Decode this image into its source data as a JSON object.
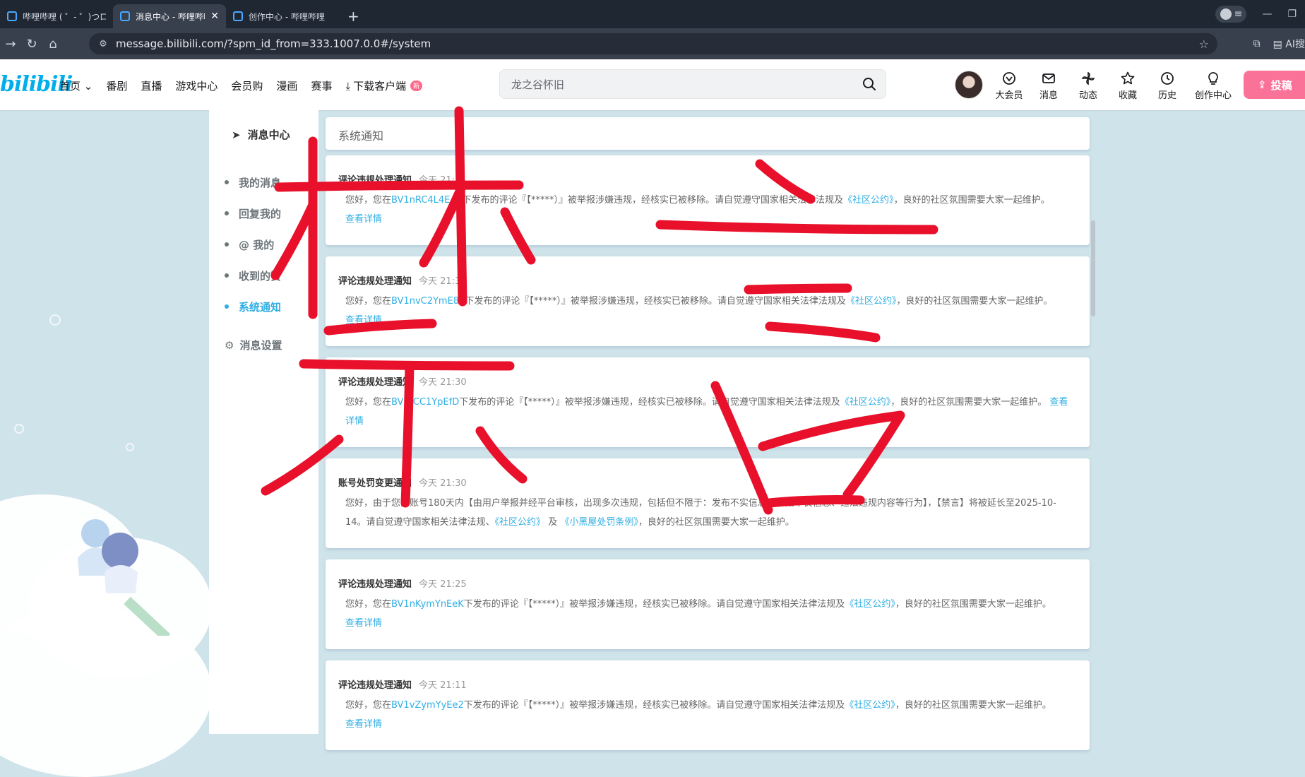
{
  "browser": {
    "tabs": [
      {
        "title": "哔哩哔哩 ( ゜- ゜)つロ",
        "active": false
      },
      {
        "title": "消息中心 - 哔哩哔哩",
        "active": true
      },
      {
        "title": "创作中心 - 哔哩哔哩",
        "active": false
      }
    ],
    "url": "message.bilibili.com/?spm_id_from=333.1007.0.0#/system",
    "ai_label": "AI搜"
  },
  "header": {
    "logo": "bilibili",
    "nav": [
      "首页",
      "番剧",
      "直播",
      "游戏中心",
      "会员购",
      "漫画",
      "赛事"
    ],
    "download_label": "下载客户端",
    "new_badge": "新",
    "search_placeholder": "龙之谷怀旧",
    "entries": [
      "大会员",
      "消息",
      "动态",
      "收藏",
      "历史",
      "创作中心"
    ],
    "upload_label": "投稿"
  },
  "sidebar": {
    "title": "消息中心",
    "items": [
      "我的消息",
      "回复我的",
      "@ 我的",
      "收到的赞",
      "系统通知"
    ],
    "active_index": 4,
    "settings": "消息设置"
  },
  "main": {
    "title": "系统通知",
    "notices": [
      {
        "kind": "评论违规处理通知",
        "time": "今天 21:31",
        "pre": "您好，您在",
        "bv": "BV1nRC4L4EAu",
        "post": "下发布的评论『【*****）』被举报涉嫌违规，经核实已被移除。请自觉遵守国家相关法律法规及",
        "rule": "《社区公约》",
        "tail": "，良好的社区氛围需要大家一起维护。",
        "detail": "查看详情"
      },
      {
        "kind": "评论违规处理通知",
        "time": "今天 21:31",
        "pre": "您好，您在",
        "bv": "BV1nvC2YmE89",
        "post": "下发布的评论『【*****）』被举报涉嫌违规，经核实已被移除。请自觉遵守国家相关法律法规及",
        "rule": "《社区公约》",
        "tail": "，良好的社区氛围需要大家一起维护。",
        "detail": "查看详情"
      },
      {
        "kind": "评论违规处理通知",
        "time": "今天 21:30",
        "pre": "您好，您在",
        "bv": "BV1tCC1YpEfD",
        "post": "下发布的评论『【*****）』被举报涉嫌违规，经核实已被移除。请自觉遵守国家相关法律法规及",
        "rule": "《社区公约》",
        "tail": "，良好的社区氛围需要大家一起维护。",
        "detail": "查看详情"
      },
      {
        "kind": "账号处罚变更通知",
        "time": "今天 21:30",
        "text": "您好，由于您的账号180天内【由用户举报并经平台审核，出现多次违规，包括但不限于：发布不实信息、传播不良信息、违法违规内容等行为】，【禁言】将被延长至2025-10-14。请自觉遵守国家相关法律法规、",
        "rule": "《社区公约》",
        "and": "及",
        "rule2": "《小黑屋处罚条例》",
        "tail": "，良好的社区氛围需要大家一起维护。"
      },
      {
        "kind": "评论违规处理通知",
        "time": "今天 21:25",
        "pre": "您好，您在",
        "bv": "BV1nKymYnEeK",
        "post": "下发布的评论『【*****）』被举报涉嫌违规，经核实已被移除。请自觉遵守国家相关法律法规及",
        "rule": "《社区公约》",
        "tail": "，良好的社区氛围需要大家一起维护。",
        "detail": "查看详情"
      },
      {
        "kind": "评论违规处理通知",
        "time": "今天 21:11",
        "pre": "您好，您在",
        "bv": "BV1vZymYyEe2",
        "post": "下发布的评论『【*****）』被举报涉嫌违规，经核实已被移除。请自觉遵守国家相关法律法规及",
        "rule": "《社区公约》",
        "tail": "，良好的社区氛围需要大家一起维护。",
        "detail": "查看详情"
      }
    ]
  },
  "colors": {
    "accent": "#2faee3",
    "brand": "#00aeec",
    "upload": "#fb7299",
    "scribble": "#e8102a"
  }
}
